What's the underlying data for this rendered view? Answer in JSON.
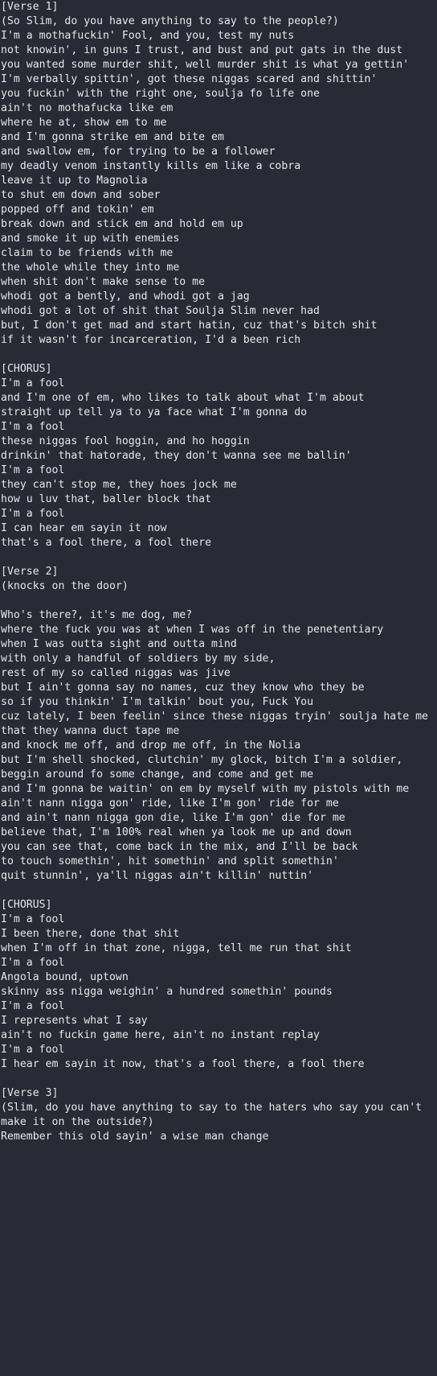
{
  "theme": {
    "background": "#282a36",
    "text": "#e6e6e6"
  },
  "lines": [
    "[Verse 1]",
    "(So Slim, do you have anything to say to the people?)",
    "I'm a mothafuckin' Fool, and you, test my nuts",
    "not knowin', in guns I trust, and bust and put gats in the dust",
    "you wanted some murder shit, well murder shit is what ya gettin'",
    "I'm verbally spittin', got these niggas scared and shittin'",
    "you fuckin' with the right one, soulja fo life one",
    "ain't no mothafucka like em",
    "where he at, show em to me",
    "and I'm gonna strike em and bite em",
    "and swallow em, for trying to be a follower",
    "my deadly venom instantly kills em like a cobra",
    "leave it up to Magnolia",
    "to shut em down and sober",
    "popped off and tokin' em",
    "break down and stick em and hold em up",
    "and smoke it up with enemies",
    "claim to be friends with me",
    "the whole while they into me",
    "when shit don't make sense to me",
    "whodi got a bently, and whodi got a jag",
    "whodi got a lot of shit that Soulja Slim never had",
    "but, I don't get mad and start hatin, cuz that's bitch shit",
    "if it wasn't for incarceration, I'd a been rich",
    "",
    "[CHORUS]",
    "I'm a fool",
    "and I'm one of em, who likes to talk about what I'm about",
    "straight up tell ya to ya face what I'm gonna do",
    "I'm a fool",
    "these niggas fool hoggin, and ho hoggin",
    "drinkin' that hatorade, they don't wanna see me ballin'",
    "I'm a fool",
    "they can't stop me, they hoes jock me",
    "how u luv that, baller block that",
    "I'm a fool",
    "I can hear em sayin it now",
    "that's a fool there, a fool there",
    "",
    "[Verse 2]",
    "(knocks on the door)",
    "",
    "Who's there?, it's me dog, me?",
    "where the fuck you was at when I was off in the penetentiary",
    "when I was outta sight and outta mind",
    "with only a handful of soldiers by my side,",
    "rest of my so called niggas was jive",
    "but I ain't gonna say no names, cuz they know who they be",
    "so if you thinkin' I'm talkin' bout you, Fuck You",
    "cuz lately, I been feelin' since these niggas tryin' soulja hate me",
    "that they wanna duct tape me",
    "and knock me off, and drop me off, in the Nolia",
    "but I'm shell shocked, clutchin' my glock, bitch I'm a soldier,",
    "beggin around fo some change, and come and get me",
    "and I'm gonna be waitin' on em by myself with my pistols with me",
    "ain't nann nigga gon' ride, like I'm gon' ride for me",
    "and ain't nann nigga gon die, like I'm gon' die for me",
    "believe that, I'm 100% real when ya look me up and down",
    "you can see that, come back in the mix, and I'll be back",
    "to touch somethin', hit somethin' and split somethin'",
    "quit stunnin', ya'll niggas ain't killin' nuttin'",
    "",
    "[CHORUS]",
    "I'm a fool",
    "I been there, done that shit",
    "when I'm off in that zone, nigga, tell me run that shit",
    "I'm a fool",
    "Angola bound, uptown",
    "skinny ass nigga weighin' a hundred somethin' pounds",
    "I'm a fool",
    "I represents what I say",
    "ain't no fuckin game here, ain't no instant replay",
    "I'm a fool",
    "I hear em sayin it now, that's a fool there, a fool there",
    "",
    "[Verse 3]",
    "(Slim, do you have anything to say to the haters who say you can't make it on the outside?)",
    "Remember this old sayin' a wise man change"
  ]
}
